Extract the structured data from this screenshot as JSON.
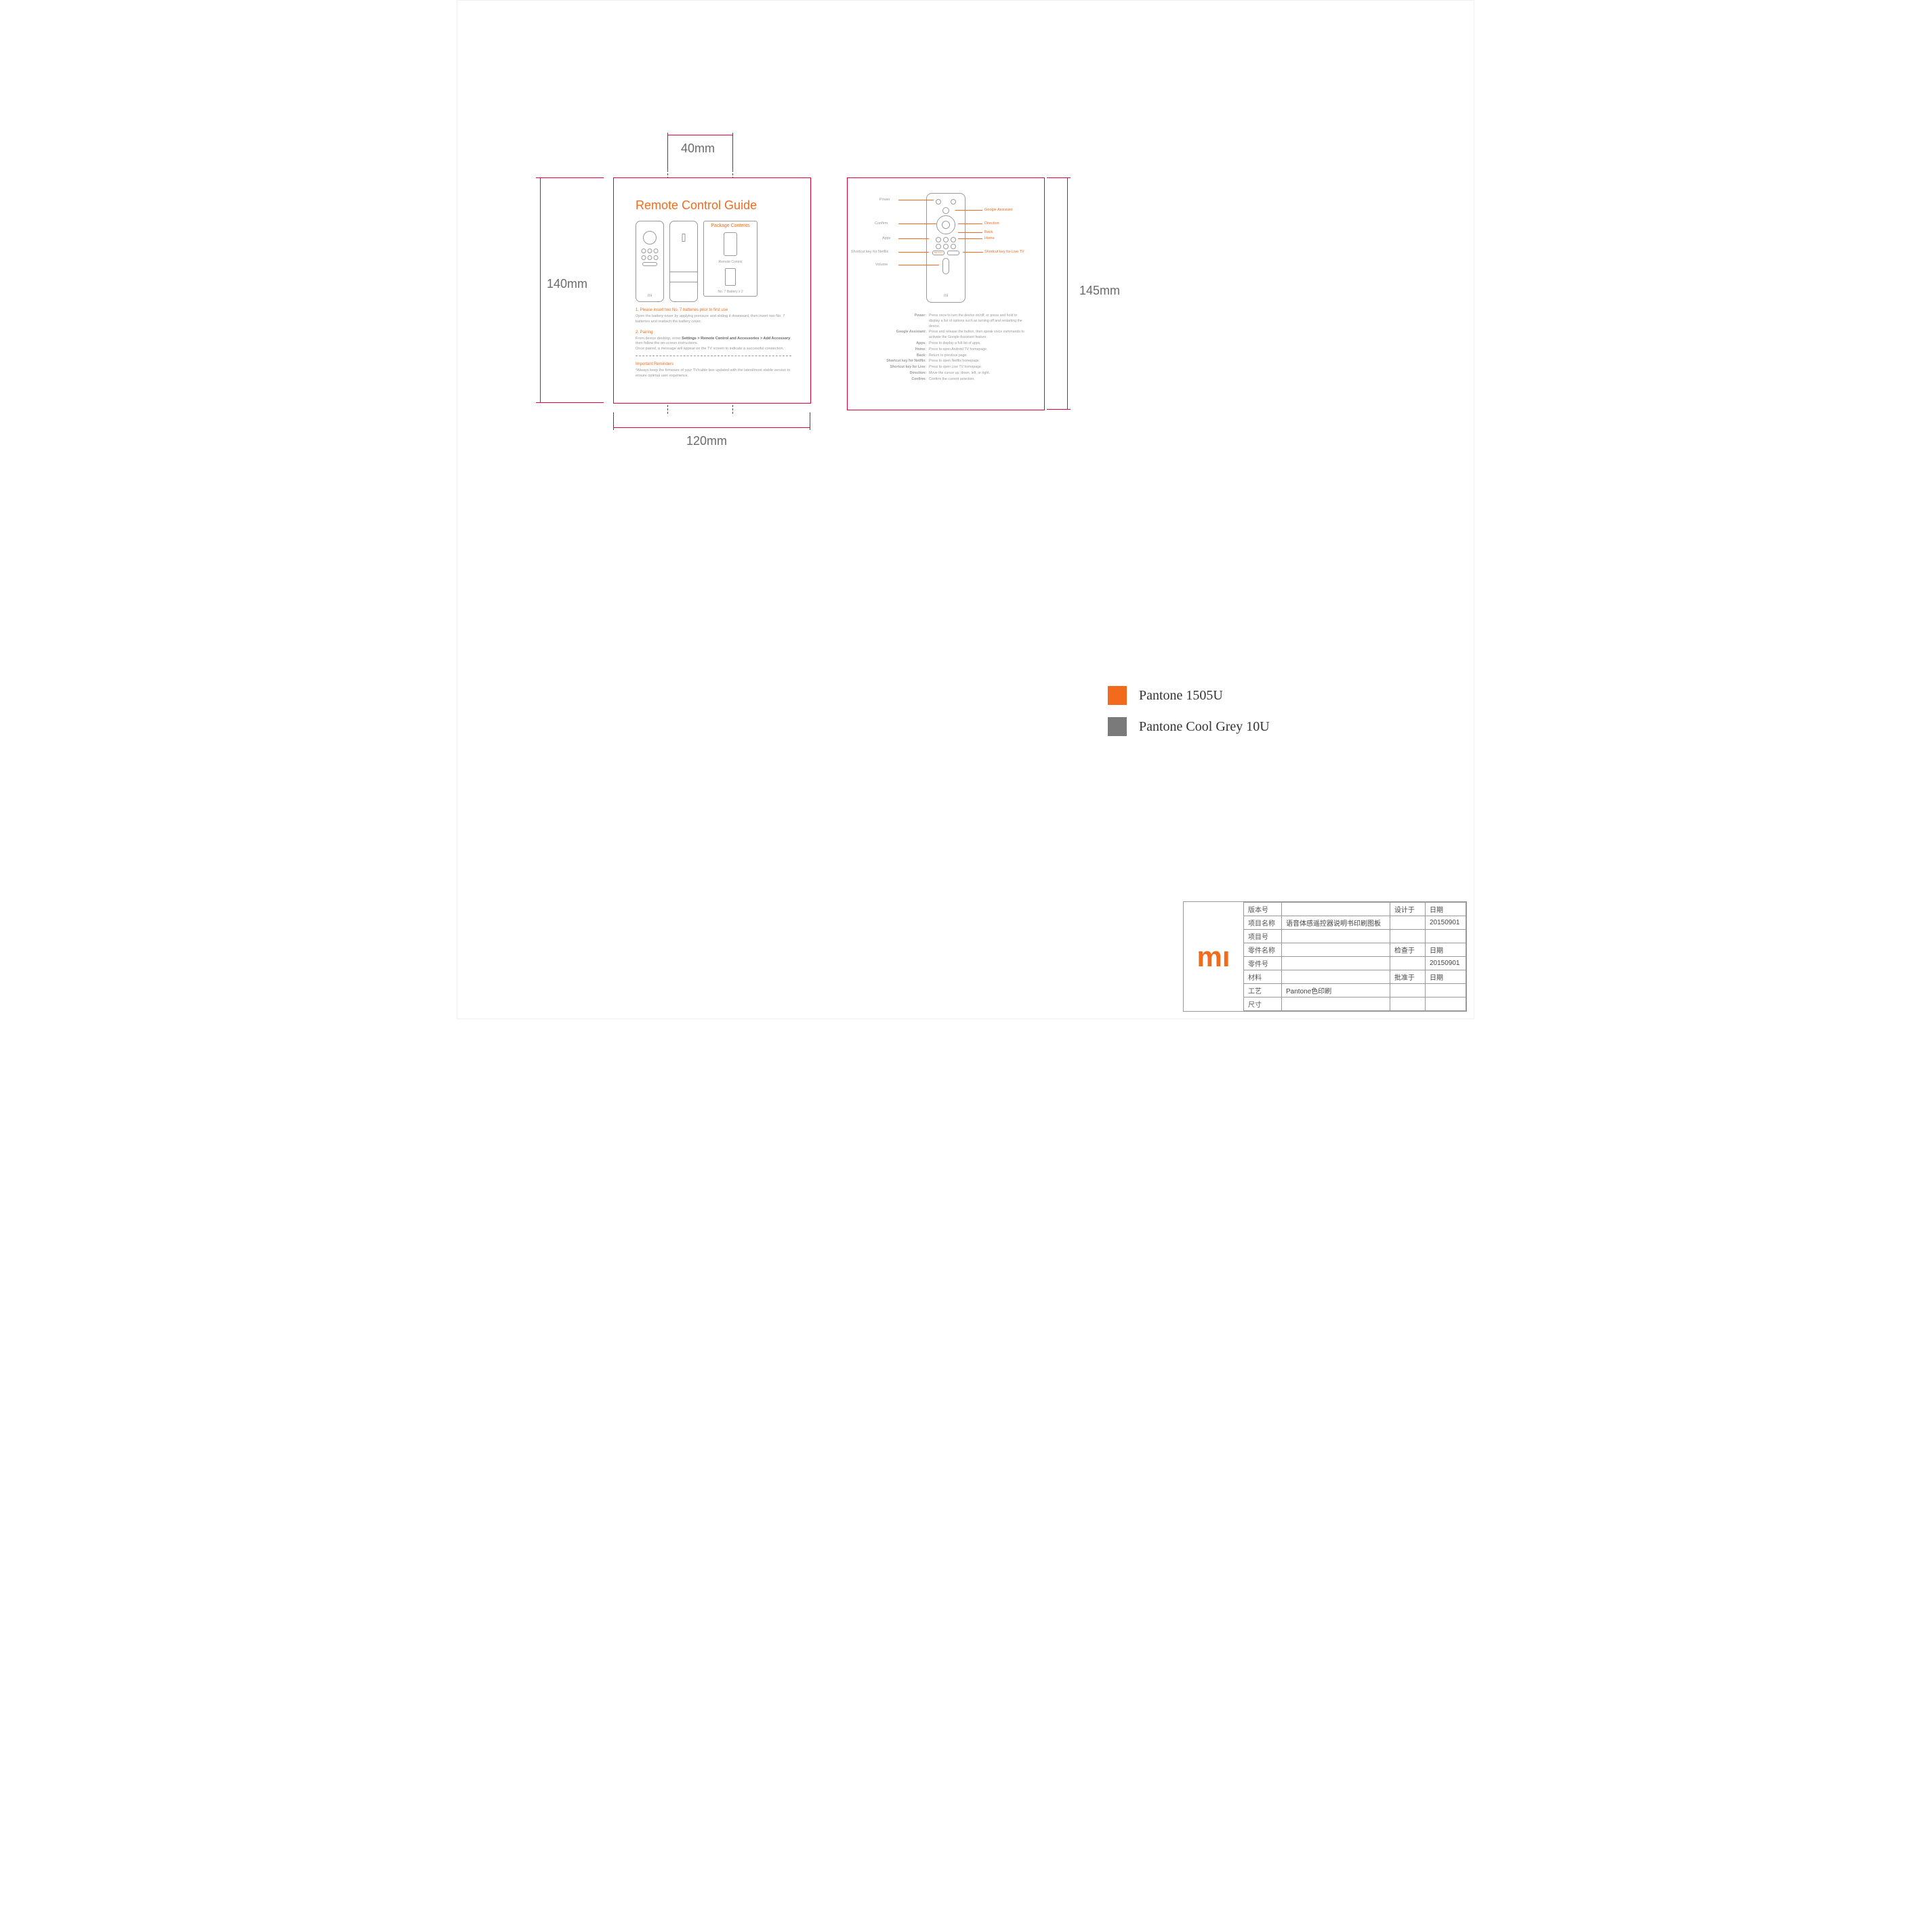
{
  "dims": {
    "top40": "40mm",
    "left140": "140mm",
    "bottom120": "120mm",
    "right145": "145mm"
  },
  "page1": {
    "title": "Remote Control Guide",
    "pkghead": "Package Contents",
    "pkg_remote": "Remote Control",
    "pkg_batt": "No. 7 Battery x 2",
    "mi": "mi",
    "s1h": "1. Please insert two No. 7 batteries prior to first use",
    "s1": "Open the battery cover by applying pressure and sliding it downward, then insert two No. 7 batteries and reattach the battery cover.",
    "s2h": "2. Pairing",
    "s2a": "From device desktop, enter ",
    "s2b": "Settings > Remote Control and Accessories > Add Accessory",
    "s2c": ", then follow the on-screen instructions.",
    "s2d": "Once paired, a message will appear on the TV screen to indicate a successful connection.",
    "s3h": "Important Reminders",
    "s3": "*Always keep the firmware of your TV/cable box updated with the latest/most stable version to ensure optimal user experience."
  },
  "page2": {
    "labels": {
      "power": "Power",
      "google": "Google Assistant",
      "confirm": "Confirm",
      "direction": "Direction",
      "back": "Back",
      "apps": "Apps",
      "home": "Home",
      "netflix": "Shortcut key for Netflix",
      "live": "Shortcut key for Live TV",
      "volume": "Volume",
      "netflix_btn": "NETFLIX"
    },
    "desc": [
      {
        "k": "Power:",
        "v": "Press once to turn the device on/off, or press and hold to display a list of options such as turning off and restarting the device."
      },
      {
        "k": "Google Assistant:",
        "v": "Press and release the button, then speak voice commands to activate the Google Assistant feature."
      },
      {
        "k": "Apps:",
        "v": "Press to display a full list of apps."
      },
      {
        "k": "Home:",
        "v": "Press to open Android TV homepage."
      },
      {
        "k": "Back:",
        "v": "Return to previous page."
      },
      {
        "k": "Shortcut key for Netflix:",
        "v": "Press to open Netflix homepage."
      },
      {
        "k": "Shortcut key for Live:",
        "v": "Press to open Live TV homepage."
      },
      {
        "k": "Direction:",
        "v": "Move the cursor up, down, left, or right."
      },
      {
        "k": "Confirm:",
        "v": "Confirm the current selection."
      }
    ]
  },
  "swatches": {
    "orange": "Pantone 1505U",
    "grey": "Pantone Cool Grey 10U"
  },
  "titleblock": {
    "rows": [
      {
        "l": "版本号",
        "v": "",
        "l2": "设计于",
        "v2": "日期"
      },
      {
        "l": "项目名称",
        "v": "语音体感遥控器说明书印刷图板",
        "l2": "",
        "v2": "20150901"
      },
      {
        "l": "项目号",
        "v": "",
        "l2": "",
        "v2": ""
      },
      {
        "l": "零件名称",
        "v": "",
        "l2": "检查于",
        "v2": "日期"
      },
      {
        "l": "零件号",
        "v": "",
        "l2": "",
        "v2": "20150901"
      },
      {
        "l": "材料",
        "v": "",
        "l2": "批准于",
        "v2": "日期"
      },
      {
        "l": "工艺",
        "v": "Pantone色印刷",
        "l2": "",
        "v2": ""
      },
      {
        "l": "尺寸",
        "v": "",
        "l2": "",
        "v2": ""
      }
    ]
  }
}
